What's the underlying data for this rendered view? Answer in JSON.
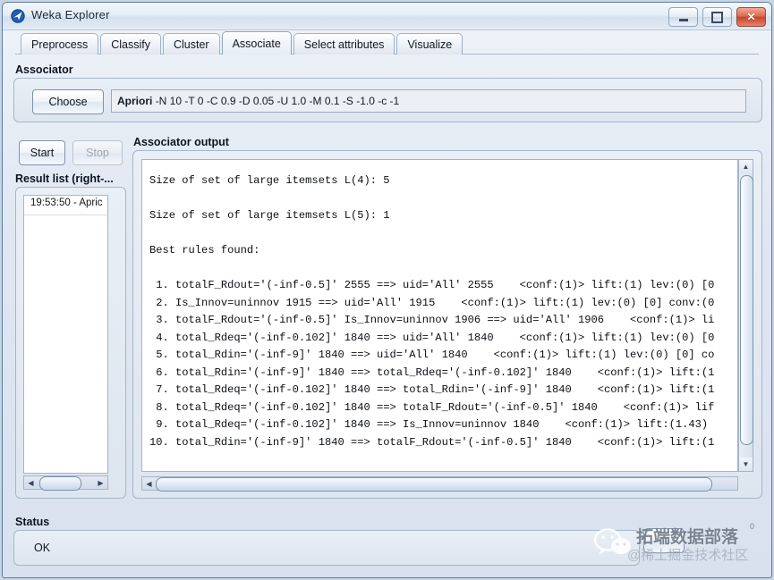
{
  "window": {
    "title": "Weka Explorer",
    "icon": "weka-bird-icon",
    "controls": {
      "minimize": "minimize-icon",
      "maximize": "maximize-icon",
      "close": "close-icon"
    }
  },
  "tabs": [
    {
      "label": "Preprocess",
      "active": false
    },
    {
      "label": "Classify",
      "active": false
    },
    {
      "label": "Cluster",
      "active": false
    },
    {
      "label": "Associate",
      "active": true
    },
    {
      "label": "Select attributes",
      "active": false
    },
    {
      "label": "Visualize",
      "active": false
    }
  ],
  "associator": {
    "group_label": "Associator",
    "choose_label": "Choose",
    "scheme_name": "Apriori",
    "scheme_options": "-N 10 -T 0 -C 0.9 -D 0.05 -U 1.0 -M 0.1 -S -1.0 -c -1"
  },
  "controls": {
    "start_label": "Start",
    "stop_label": "Stop",
    "stop_enabled": false
  },
  "result_list": {
    "group_label": "Result list (right-...",
    "items": [
      "19:53:50 - Apric"
    ]
  },
  "output": {
    "group_label": "Associator output",
    "lines": [
      "Size of set of large itemsets L(4): 5",
      "",
      "Size of set of large itemsets L(5): 1",
      "",
      "Best rules found:",
      "",
      " 1. totalF_Rdout='(-inf-0.5]' 2555 ==> uid='All' 2555    <conf:(1)> lift:(1) lev:(0) [0",
      " 2. Is_Innov=uninnov 1915 ==> uid='All' 1915    <conf:(1)> lift:(1) lev:(0) [0] conv:(0",
      " 3. totalF_Rdout='(-inf-0.5]' Is_Innov=uninnov 1906 ==> uid='All' 1906    <conf:(1)> li",
      " 4. total_Rdeq='(-inf-0.102]' 1840 ==> uid='All' 1840    <conf:(1)> lift:(1) lev:(0) [0",
      " 5. total_Rdin='(-inf-9]' 1840 ==> uid='All' 1840    <conf:(1)> lift:(1) lev:(0) [0] co",
      " 6. total_Rdin='(-inf-9]' 1840 ==> total_Rdeq='(-inf-0.102]' 1840    <conf:(1)> lift:(1",
      " 7. total_Rdeq='(-inf-0.102]' 1840 ==> total_Rdin='(-inf-9]' 1840    <conf:(1)> lift:(1",
      " 8. total_Rdeq='(-inf-0.102]' 1840 ==> totalF_Rdout='(-inf-0.5]' 1840    <conf:(1)> lif",
      " 9. total_Rdeq='(-inf-0.102]' 1840 ==> Is_Innov=uninnov 1840    <conf:(1)> lift:(1.43)",
      "10. total_Rdin='(-inf-9]' 1840 ==> totalF_Rdout='(-inf-0.5]' 1840    <conf:(1)> lift:(1"
    ]
  },
  "status": {
    "group_label": "Status",
    "text": "OK",
    "log_button": "log-button"
  },
  "watermark": {
    "line1": "拓端数据部落",
    "registered": "0",
    "line2": "@稀土掘金技术社区",
    "icon": "wechat-icon"
  },
  "scrollbars": {
    "output_vertical": "output-vertical-scrollbar",
    "output_horizontal": "output-horizontal-scrollbar",
    "result_horizontal": "result-list-horizontal-scrollbar"
  }
}
